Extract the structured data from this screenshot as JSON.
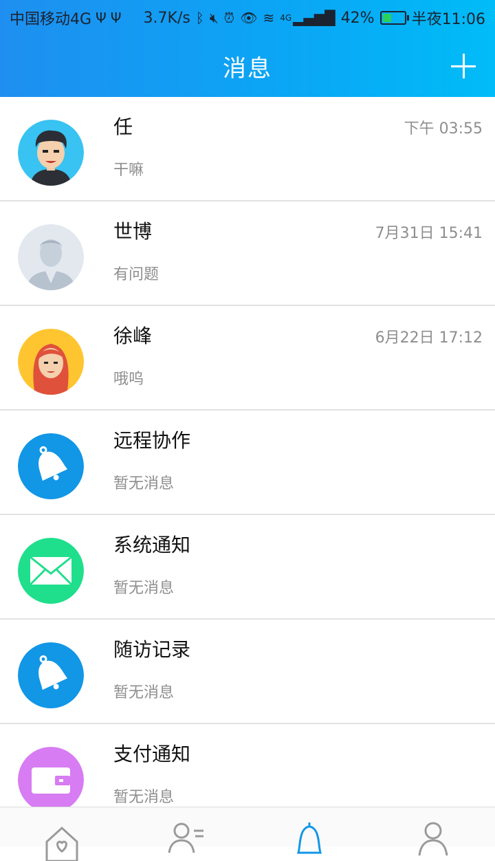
{
  "status_bar": {
    "carrier": "中国移动4G",
    "net_speed": "3.7K/s",
    "signal_label": "4G",
    "battery": "42%",
    "battery_level": 0.42,
    "time": "半夜11:06"
  },
  "header": {
    "title": "消息"
  },
  "conversations": [
    {
      "name": "任",
      "preview": "干嘛",
      "time": "下午 03:55",
      "avatar": "man-cartoon-avatar"
    },
    {
      "name": "世博",
      "preview": "有问题",
      "time": "7月31日 15:41",
      "avatar": "doctor-placeholder-avatar"
    },
    {
      "name": "徐峰",
      "preview": "哦呜",
      "time": "6月22日 17:12",
      "avatar": "woman-cartoon-avatar"
    },
    {
      "name": "远程协作",
      "preview": "暂无消息",
      "time": "",
      "avatar": "bell-icon"
    },
    {
      "name": "系统通知",
      "preview": "暂无消息",
      "time": "",
      "avatar": "envelope-icon"
    },
    {
      "name": "随访记录",
      "preview": "暂无消息",
      "time": "",
      "avatar": "bell-icon"
    },
    {
      "name": "支付通知",
      "preview": "暂无消息",
      "time": "",
      "avatar": "wallet-icon"
    }
  ],
  "tabs": [
    {
      "icon": "home-heart-icon"
    },
    {
      "icon": "contacts-icon"
    },
    {
      "icon": "bell-icon",
      "active": true
    },
    {
      "icon": "person-icon"
    }
  ],
  "colors": {
    "header_start": "#1e8ff0",
    "header_end": "#00bcf7",
    "accent": "#1296e6",
    "bell_blue": "#1296e6",
    "mail_green": "#1fdf8c",
    "wallet_purple": "#d77cf2"
  }
}
